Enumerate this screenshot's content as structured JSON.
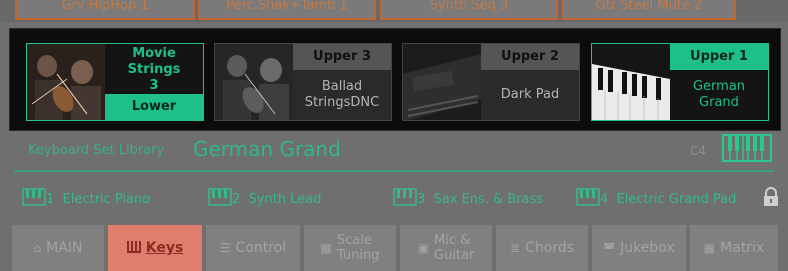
{
  "top_pads": [
    "Grv HipHop 1",
    "Perc Snak+Tamb 1",
    "Synth Seq 3",
    "Gtr Steel Mute 2"
  ],
  "sounds": [
    {
      "name_line1": "Movie Strings",
      "name_line2": "3",
      "role": "Lower",
      "image": "strings-photo"
    },
    {
      "header": "Upper 3",
      "value_line1": "Ballad",
      "value_line2": "StringsDNC",
      "image": "strings-photo"
    },
    {
      "header": "Upper 2",
      "value_line1": "Dark Pad",
      "value_line2": "",
      "image": "synth-photo"
    },
    {
      "header": "Upper 1",
      "value_line1": "German",
      "value_line2": "Grand",
      "image": "piano-photo"
    }
  ],
  "library": {
    "label": "Keyboard Set Library",
    "name": "German Grand",
    "note": "C4"
  },
  "favorites": [
    {
      "num": "1",
      "label": "Electric Piano"
    },
    {
      "num": "2",
      "label": "Synth Lead"
    },
    {
      "num": "3",
      "label": "Sax Ens. & Brass"
    },
    {
      "num": "4",
      "label": "Electric Grand Pad"
    }
  ],
  "tabs": [
    {
      "label": "MAIN",
      "icon": "home-icon"
    },
    {
      "label": "Keys",
      "icon": "keys-icon",
      "active": true
    },
    {
      "label": "Control",
      "icon": "sliders-icon"
    },
    {
      "label1": "Scale",
      "label2": "Tuning",
      "icon": "scale-icon"
    },
    {
      "label1": "Mic &",
      "label2": "Guitar",
      "icon": "mic-icon"
    },
    {
      "label": "Chords",
      "icon": "chords-icon"
    },
    {
      "label": "Jukebox",
      "icon": "jukebox-icon"
    },
    {
      "label": "Matrix",
      "icon": "matrix-icon"
    }
  ],
  "colors": {
    "accent": "#1ec089",
    "active_tab": "#e07d6d",
    "pad_border": "#c2662d"
  }
}
